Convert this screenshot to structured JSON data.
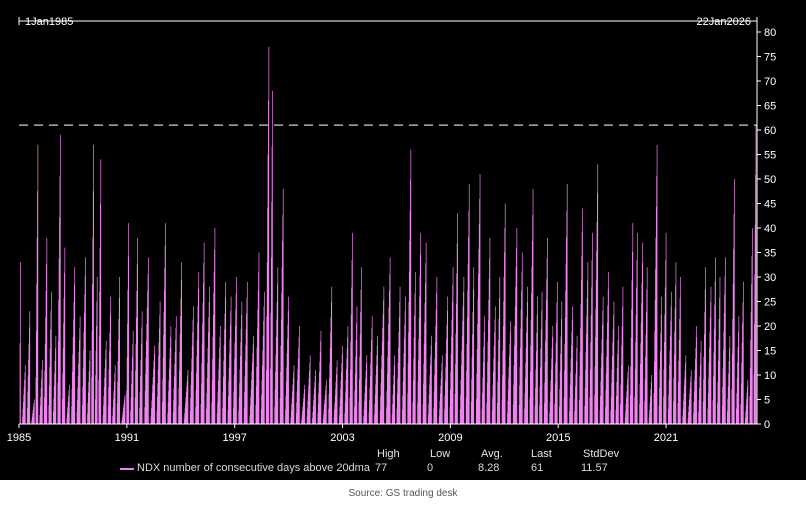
{
  "chart_data": {
    "type": "bar",
    "title": "",
    "xlabel": "",
    "ylabel": "",
    "start_label": "1Jan1985",
    "end_label": "22Jan2026",
    "x_range": [
      1985.0,
      2026.06
    ],
    "ylim": [
      0,
      80
    ],
    "x_ticks": [
      "1985",
      "1991",
      "1997",
      "2003",
      "2009",
      "2015",
      "2021"
    ],
    "y_ticks": [
      "0",
      "5",
      "10",
      "15",
      "20",
      "25",
      "30",
      "35",
      "40",
      "45",
      "50",
      "55",
      "60",
      "65",
      "70",
      "75",
      "80"
    ],
    "y_axis_side": "right",
    "grid": false,
    "reference_line": {
      "value": 61,
      "style": "dashed",
      "color": "#d0d0d0"
    },
    "series_color": "#ee82ee",
    "series": [
      {
        "name": "NDX number of consecutive days above 20dma",
        "points": [
          [
            1985.08,
            33
          ],
          [
            1985.35,
            12
          ],
          [
            1985.6,
            23
          ],
          [
            1985.85,
            5
          ],
          [
            1986.05,
            57
          ],
          [
            1986.3,
            13
          ],
          [
            1986.55,
            38
          ],
          [
            1986.8,
            27
          ],
          [
            1987.05,
            18
          ],
          [
            1987.3,
            59
          ],
          [
            1987.55,
            36
          ],
          [
            1987.8,
            8
          ],
          [
            1988.1,
            32
          ],
          [
            1988.4,
            22
          ],
          [
            1988.7,
            34
          ],
          [
            1988.95,
            15
          ],
          [
            1989.15,
            57
          ],
          [
            1989.35,
            30
          ],
          [
            1989.55,
            54
          ],
          [
            1989.85,
            17
          ],
          [
            1990.1,
            26
          ],
          [
            1990.35,
            12
          ],
          [
            1990.6,
            30
          ],
          [
            1990.9,
            6
          ],
          [
            1991.1,
            41
          ],
          [
            1991.35,
            19
          ],
          [
            1991.6,
            38
          ],
          [
            1991.85,
            23
          ],
          [
            1992.2,
            34
          ],
          [
            1992.55,
            16
          ],
          [
            1992.85,
            25
          ],
          [
            1993.15,
            41
          ],
          [
            1993.45,
            20
          ],
          [
            1993.75,
            22
          ],
          [
            1994.05,
            33
          ],
          [
            1994.4,
            11
          ],
          [
            1994.7,
            24
          ],
          [
            1995.0,
            31
          ],
          [
            1995.3,
            37
          ],
          [
            1995.6,
            28
          ],
          [
            1995.9,
            40
          ],
          [
            1996.2,
            20
          ],
          [
            1996.5,
            29
          ],
          [
            1996.8,
            26
          ],
          [
            1997.1,
            30
          ],
          [
            1997.4,
            25
          ],
          [
            1997.7,
            29
          ],
          [
            1998.05,
            18
          ],
          [
            1998.35,
            35
          ],
          [
            1998.65,
            27
          ],
          [
            1998.9,
            77
          ],
          [
            1999.1,
            68
          ],
          [
            1999.4,
            32
          ],
          [
            1999.7,
            48
          ],
          [
            2000.0,
            26
          ],
          [
            2000.3,
            12
          ],
          [
            2000.6,
            20
          ],
          [
            2000.9,
            8
          ],
          [
            2001.2,
            14
          ],
          [
            2001.5,
            11
          ],
          [
            2001.8,
            19
          ],
          [
            2002.1,
            9
          ],
          [
            2002.4,
            28
          ],
          [
            2002.7,
            13
          ],
          [
            2003.0,
            16
          ],
          [
            2003.3,
            20
          ],
          [
            2003.55,
            39
          ],
          [
            2003.8,
            24
          ],
          [
            2004.05,
            32
          ],
          [
            2004.35,
            14
          ],
          [
            2004.65,
            22
          ],
          [
            2004.95,
            18
          ],
          [
            2005.3,
            28
          ],
          [
            2005.65,
            34
          ],
          [
            2005.9,
            14
          ],
          [
            2006.2,
            28
          ],
          [
            2006.5,
            26
          ],
          [
            2006.8,
            56
          ],
          [
            2007.05,
            31
          ],
          [
            2007.35,
            39
          ],
          [
            2007.65,
            37
          ],
          [
            2007.95,
            18
          ],
          [
            2008.25,
            30
          ],
          [
            2008.55,
            14
          ],
          [
            2008.85,
            26
          ],
          [
            2009.15,
            32
          ],
          [
            2009.4,
            43
          ],
          [
            2009.75,
            30
          ],
          [
            2010.05,
            49
          ],
          [
            2010.3,
            32
          ],
          [
            2010.65,
            51
          ],
          [
            2010.9,
            22
          ],
          [
            2011.2,
            38
          ],
          [
            2011.5,
            24
          ],
          [
            2011.75,
            30
          ],
          [
            2012.05,
            45
          ],
          [
            2012.35,
            21
          ],
          [
            2012.7,
            40
          ],
          [
            2013.0,
            35
          ],
          [
            2013.3,
            28
          ],
          [
            2013.6,
            48
          ],
          [
            2013.85,
            26
          ],
          [
            2014.1,
            27
          ],
          [
            2014.4,
            38
          ],
          [
            2014.7,
            20
          ],
          [
            2014.95,
            29
          ],
          [
            2015.2,
            25
          ],
          [
            2015.5,
            49
          ],
          [
            2015.8,
            24
          ],
          [
            2016.05,
            18
          ],
          [
            2016.35,
            44
          ],
          [
            2016.65,
            33
          ],
          [
            2016.9,
            39
          ],
          [
            2017.2,
            53
          ],
          [
            2017.5,
            26
          ],
          [
            2017.8,
            31
          ],
          [
            2018.1,
            25
          ],
          [
            2018.35,
            20
          ],
          [
            2018.6,
            28
          ],
          [
            2018.9,
            12
          ],
          [
            2019.15,
            41
          ],
          [
            2019.4,
            39
          ],
          [
            2019.7,
            37
          ],
          [
            2019.95,
            32
          ],
          [
            2020.2,
            10
          ],
          [
            2020.5,
            57
          ],
          [
            2020.75,
            26
          ],
          [
            2021.0,
            39
          ],
          [
            2021.3,
            27
          ],
          [
            2021.55,
            33
          ],
          [
            2021.8,
            30
          ],
          [
            2022.1,
            14
          ],
          [
            2022.4,
            11
          ],
          [
            2022.7,
            20
          ],
          [
            2022.95,
            17
          ],
          [
            2023.2,
            32
          ],
          [
            2023.5,
            28
          ],
          [
            2023.75,
            34
          ],
          [
            2024.0,
            30
          ],
          [
            2024.3,
            34
          ],
          [
            2024.55,
            18
          ],
          [
            2024.8,
            50
          ],
          [
            2025.05,
            22
          ],
          [
            2025.3,
            29
          ],
          [
            2025.55,
            9
          ],
          [
            2025.8,
            40
          ],
          [
            2026.0,
            61
          ]
        ]
      }
    ],
    "stats": {
      "headers": [
        "High",
        "Low",
        "Avg.",
        "Last",
        "StdDev"
      ],
      "values": [
        "77",
        "0",
        "8.28",
        "61",
        "11.57"
      ]
    }
  },
  "source": "Source: GS trading desk"
}
